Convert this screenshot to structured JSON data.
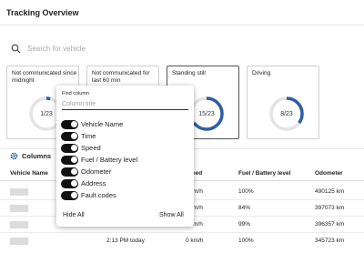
{
  "page": {
    "title": "Tracking Overview"
  },
  "search": {
    "placeholder": "Search for vehicle"
  },
  "cards": [
    {
      "label": "Not communicated since midnight",
      "value": "1/23",
      "fraction": 0.04
    },
    {
      "label": "Not communicated for last 60 min",
      "value": "",
      "fraction": 0
    },
    {
      "label": "Standing still",
      "value": "15/23",
      "fraction": 0.65
    },
    {
      "label": "Driving",
      "value": "8/23",
      "fraction": 0.35
    }
  ],
  "accent_color": "#2d5fa3",
  "columns_button": {
    "label": "Columns"
  },
  "table": {
    "headers": [
      "Vehicle Name",
      "Speed",
      "Fuel / Battery level",
      "Odometer"
    ],
    "header_partial_speed": "eed",
    "rows": [
      {
        "time": "",
        "speed": "m/h",
        "fuel": "100%",
        "odometer": "490125 km"
      },
      {
        "time": "",
        "speed": "m/h",
        "fuel": "84%",
        "odometer": "397073 km"
      },
      {
        "time": "",
        "speed": "m/h",
        "fuel": "99%",
        "odometer": "396357 km"
      },
      {
        "time": "2:13 PM today",
        "speed": "0 km/h",
        "fuel": "100%",
        "odometer": "345723 km"
      }
    ]
  },
  "column_popup": {
    "find_label": "Find column",
    "find_placeholder": "Column title",
    "options": [
      {
        "label": "Vehicle Name",
        "on": true
      },
      {
        "label": "Time",
        "on": true
      },
      {
        "label": "Speed",
        "on": true
      },
      {
        "label": "Fuel / Battery level",
        "on": true
      },
      {
        "label": "Odometer",
        "on": true
      },
      {
        "label": "Address",
        "on": true
      },
      {
        "label": "Fault codes",
        "on": true
      }
    ],
    "hide_all": "Hide All",
    "show_all": "Show All"
  }
}
